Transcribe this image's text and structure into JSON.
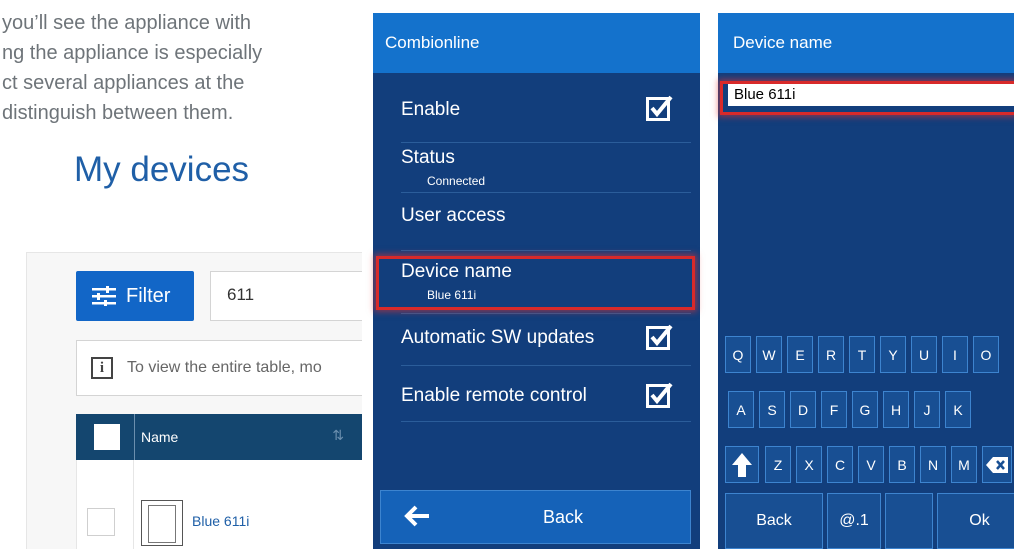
{
  "doc": {
    "intro_lines": [
      "you’ll see the appliance with",
      "ng the appliance is especially",
      "ct several appliances at the",
      "distinguish between them."
    ],
    "heading": "My devices",
    "filter_label": "Filter",
    "search_value": "611",
    "info_text": "To view the entire table, mo",
    "column_name": "Name",
    "rows": [
      {
        "name": "Blue 611i"
      }
    ]
  },
  "screen_settings": {
    "title": "Combionline",
    "items": [
      {
        "label": "Enable",
        "checked": true
      },
      {
        "label": "Status",
        "sub": "Connected"
      },
      {
        "label": "User access"
      },
      {
        "label": "Device name",
        "sub": "Blue 611i"
      },
      {
        "label": "Automatic SW updates",
        "checked": true
      },
      {
        "label": "Enable remote control",
        "checked": true
      }
    ],
    "back_label": "Back"
  },
  "screen_name": {
    "title": "Device name",
    "input_value": "Blue 611i",
    "keyboard": {
      "row1": [
        "Q",
        "W",
        "E",
        "R",
        "T",
        "Y",
        "U",
        "I",
        "O"
      ],
      "row2": [
        "A",
        "S",
        "D",
        "F",
        "G",
        "H",
        "J",
        "K"
      ],
      "row3": [
        "Z",
        "X",
        "C",
        "V",
        "B",
        "N",
        "M"
      ],
      "back_label": "Back",
      "symbols_label": "@.1",
      "ok_label": "Ok"
    }
  },
  "colors": {
    "screen_bg": "#123e7c",
    "title_bar": "#1472cc",
    "highlight": "#d82a2a",
    "link_blue": "#1f5fa7",
    "filter_button": "#1266c7",
    "table_header": "#14466f"
  }
}
